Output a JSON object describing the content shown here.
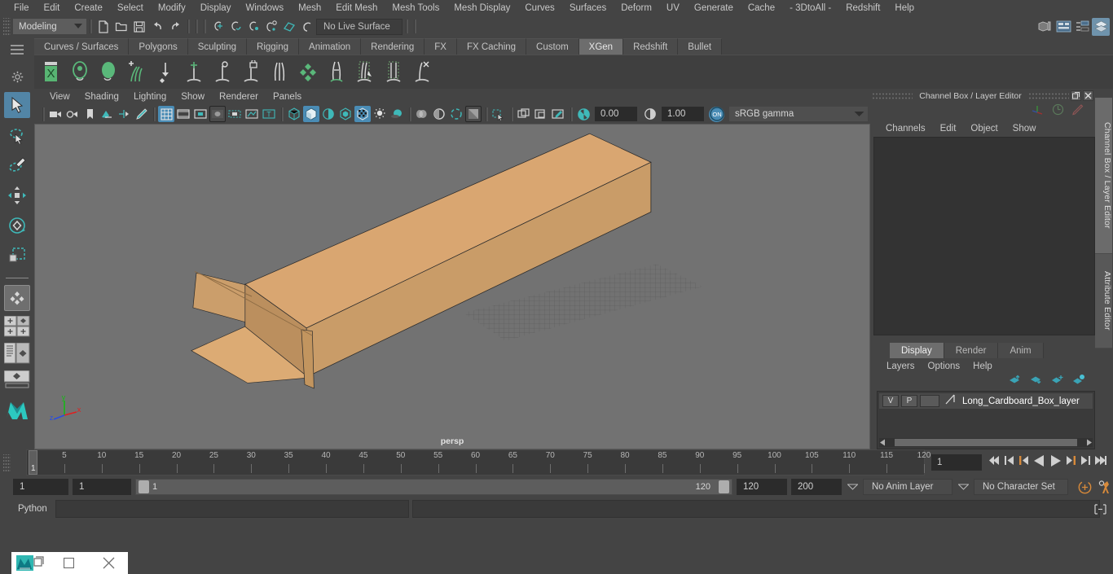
{
  "app": {
    "title": "Autodesk Maya"
  },
  "menubar": {
    "items": [
      "File",
      "Edit",
      "Create",
      "Select",
      "Modify",
      "Display",
      "Windows",
      "Mesh",
      "Edit Mesh",
      "Mesh Tools",
      "Mesh Display",
      "Curves",
      "Surfaces",
      "Deform",
      "UV",
      "Generate",
      "Cache",
      "- 3DtoAll -",
      "Redshift",
      "Help"
    ]
  },
  "statusline": {
    "mode": "Modeling",
    "live_surface": "No Live Surface",
    "icons": [
      "new-scene-icon",
      "open-scene-icon",
      "save-scene-icon",
      "undo-icon",
      "redo-icon",
      "select-by-hierarchy-icon",
      "select-by-object-icon",
      "select-by-component-icon",
      "snap-to-grid-icon",
      "snap-to-curve-icon",
      "snap-to-point-icon",
      "snap-to-projected-center-icon",
      "snap-to-view-plane-icon",
      "make-live-icon"
    ],
    "right_icons": [
      "show-hide-modeling-toolkit-icon",
      "show-hide-attribute-editor-icon",
      "show-hide-tool-settings-icon",
      "show-hide-channel-box-icon"
    ]
  },
  "shelf": {
    "tabs": [
      "Curves / Surfaces",
      "Polygons",
      "Sculpting",
      "Rigging",
      "Animation",
      "Rendering",
      "FX",
      "FX Caching",
      "Custom",
      "XGen",
      "Redshift",
      "Bullet"
    ],
    "active_tab": "XGen",
    "icons": [
      "xgen-editor-icon",
      "xgen-create-description-icon",
      "xgen-create-palette-icon",
      "xgen-add-groom-icon",
      "xgen-place-and-scale-icon",
      "xgen-density-icon",
      "xgen-region-icon",
      "xgen-lock-icon",
      "xgen-part-icon",
      "xgen-noise-icon",
      "xgen-cut-icon",
      "xgen-clump-icon",
      "xgen-guide-icon",
      "xgen-delete-icon"
    ]
  },
  "toolbox": {
    "items": [
      "select-tool",
      "lasso-select-tool",
      "paint-select-tool",
      "move-tool",
      "rotate-tool",
      "scale-tool",
      "last-tool-used",
      "snap-modes",
      "outliner-persp-layout",
      "persp-layout",
      "hypershade-persp-layout",
      "maya-logo"
    ]
  },
  "viewport": {
    "menus": [
      "View",
      "Shading",
      "Lighting",
      "Show",
      "Renderer",
      "Panels"
    ],
    "camera_label": "persp",
    "exposure": "0.00",
    "gamma": "1.00",
    "color_space": "sRGB gamma",
    "axis_labels": {
      "x": "x",
      "y": "y",
      "z": "z"
    },
    "background_color": "#727272",
    "model_color": "#dcaa73",
    "toolbar_icons": [
      "select-camera-icon",
      "camera-attributes-icon",
      "bookmarks-icon",
      "image-plane-icon",
      "two-d-pan-zoom-icon",
      "grease-pencil-icon",
      "grid-icon",
      "film-gate-icon",
      "resolution-gate-icon",
      "gate-mask-icon",
      "film-origin-icon",
      "safe-action-icon",
      "safe-title-icon",
      "wireframe-icon",
      "smooth-shade-all-icon",
      "shaded-wireframe-icon",
      "use-default-material-icon",
      "textured-icon",
      "use-all-lights-icon",
      "shadows-icon",
      "screen-space-ao-icon",
      "motion-blur-icon",
      "multisample-aa-icon",
      "isolate-select-icon",
      "xray-icon",
      "xray-joints-icon",
      "xray-active-components-icon",
      "exposure-icon",
      "gamma-icon",
      "color-management-toggle-icon"
    ]
  },
  "channel_box": {
    "title": "Channel Box / Layer Editor",
    "menus": [
      "Channels",
      "Edit",
      "Object",
      "Show"
    ],
    "window_buttons": [
      "undock-icon",
      "close-icon"
    ],
    "header_icons": [
      "axis-gizmo-icon",
      "clock-icon",
      "pencil-icon"
    ]
  },
  "vertical_tabs": [
    "Channel Box / Layer Editor",
    "Attribute Editor"
  ],
  "layer_editor": {
    "tabs": [
      "Display",
      "Render",
      "Anim"
    ],
    "active_tab": "Display",
    "menus": [
      "Layers",
      "Options",
      "Help"
    ],
    "buttons": [
      "move-layer-up-icon",
      "move-layer-down-icon",
      "create-empty-layer-icon",
      "create-layer-from-selected-icon"
    ],
    "layers": [
      {
        "visibility": "V",
        "playback": "P",
        "color_swatch": "",
        "name": "Long_Cardboard_Box_layer"
      }
    ]
  },
  "timeline": {
    "ticks": [
      5,
      10,
      15,
      20,
      25,
      30,
      35,
      40,
      45,
      50,
      55,
      60,
      65,
      70,
      75,
      80,
      85,
      90,
      95,
      100,
      105,
      110,
      115,
      120
    ],
    "current_frame": "1",
    "frame_field": "1",
    "playback_buttons": [
      "go-to-start-icon",
      "step-back-keyframe-icon",
      "step-back-frame-icon",
      "play-backwards-icon",
      "play-forwards-icon",
      "step-forward-frame-icon",
      "step-forward-keyframe-icon",
      "go-to-end-icon"
    ]
  },
  "range": {
    "start": "1",
    "playback_start": "1",
    "slider_min_label": "1",
    "slider_max_label": "120",
    "playback_end": "120",
    "end": "200",
    "anim_layer": "No Anim Layer",
    "character_set": "No Character Set",
    "right_icons": [
      "auto-keyframe-icon",
      "animation-preferences-icon"
    ]
  },
  "command_line": {
    "language": "Python",
    "input_value": "",
    "result_value": "",
    "script-editor-icon": "script-editor-icon"
  },
  "window_controls": {
    "items": [
      "restore-icon",
      "maximize-icon",
      "close-icon"
    ]
  }
}
